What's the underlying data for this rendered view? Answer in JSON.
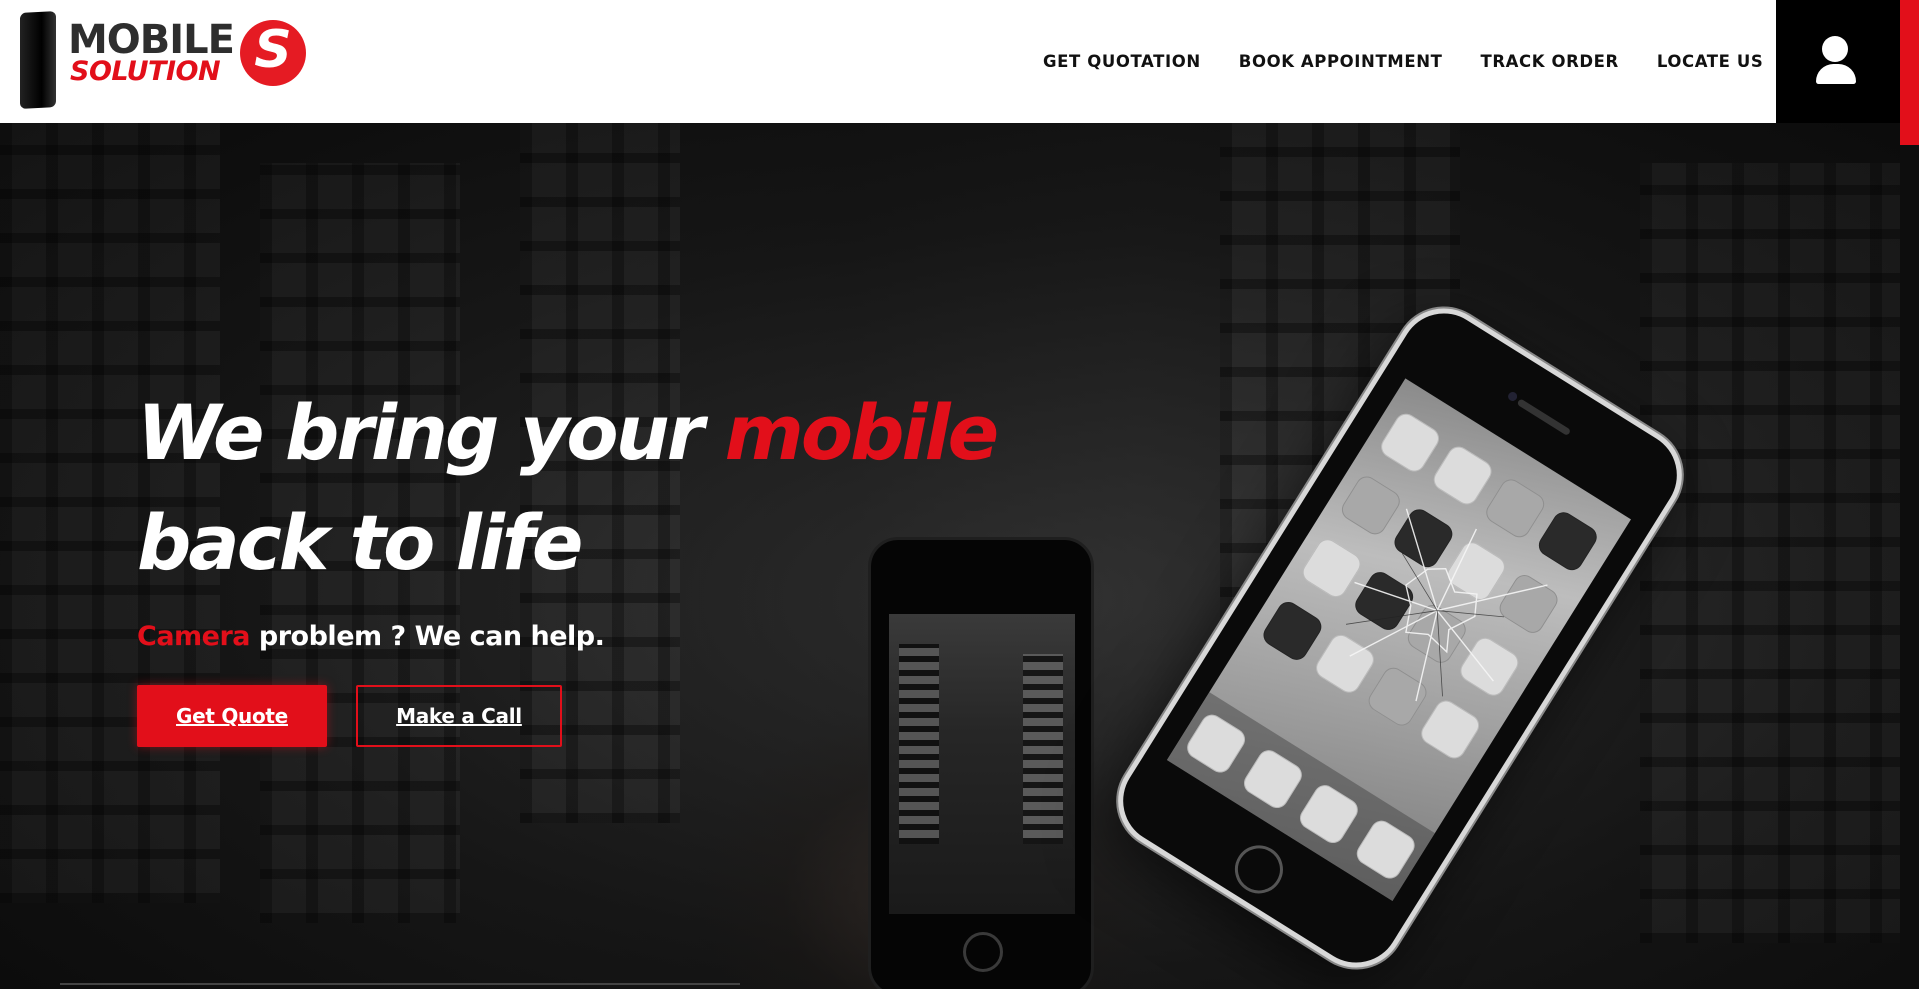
{
  "header": {
    "logo": {
      "line1": "MOBILE",
      "line2": "SOLUTION",
      "badge_letter": "S"
    },
    "nav": [
      {
        "label": "GET QUOTATION"
      },
      {
        "label": "BOOK APPOINTMENT"
      },
      {
        "label": "TRACK ORDER"
      },
      {
        "label": "LOCATE US"
      }
    ],
    "user_icon": "user-icon"
  },
  "hero": {
    "headline": {
      "part1": "We bring your ",
      "accent": "mobile",
      "part2": "back to life"
    },
    "subline": {
      "accent": "Camera",
      "rest": " problem ? We can help."
    },
    "buttons": {
      "quote": "Get Quote",
      "call": "Make a Call"
    }
  },
  "colors": {
    "accent": "#e20f1a",
    "header_bg": "#ffffff",
    "hero_bg": "#161616",
    "user_box_bg": "#000000"
  }
}
